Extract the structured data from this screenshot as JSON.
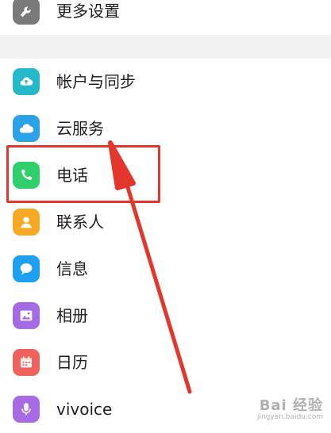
{
  "settings": {
    "items": [
      {
        "label": "更多设置",
        "icon": "wrench-icon",
        "color": "#7a7a7a"
      },
      {
        "label": "帐户与同步",
        "icon": "cloud-sync-icon",
        "color": "#24b8c9"
      },
      {
        "label": "云服务",
        "icon": "cloud-icon",
        "color": "#2ba2e7"
      },
      {
        "label": "电话",
        "icon": "phone-icon",
        "color": "#2fd06b"
      },
      {
        "label": "联系人",
        "icon": "contact-icon",
        "color": "#f9a824"
      },
      {
        "label": "信息",
        "icon": "message-icon",
        "color": "#1f9ff0"
      },
      {
        "label": "相册",
        "icon": "photo-album-icon",
        "color": "#a56be5"
      },
      {
        "label": "日历",
        "icon": "calendar-icon",
        "color": "#f0625d"
      },
      {
        "label": "vivoice",
        "icon": "microphone-icon",
        "color": "#a76ce4"
      }
    ]
  },
  "annotation": {
    "highlight_color": "#e3362d"
  },
  "watermark": {
    "brand": "Bai 经验",
    "sub": "jingyan.baidu.com"
  }
}
